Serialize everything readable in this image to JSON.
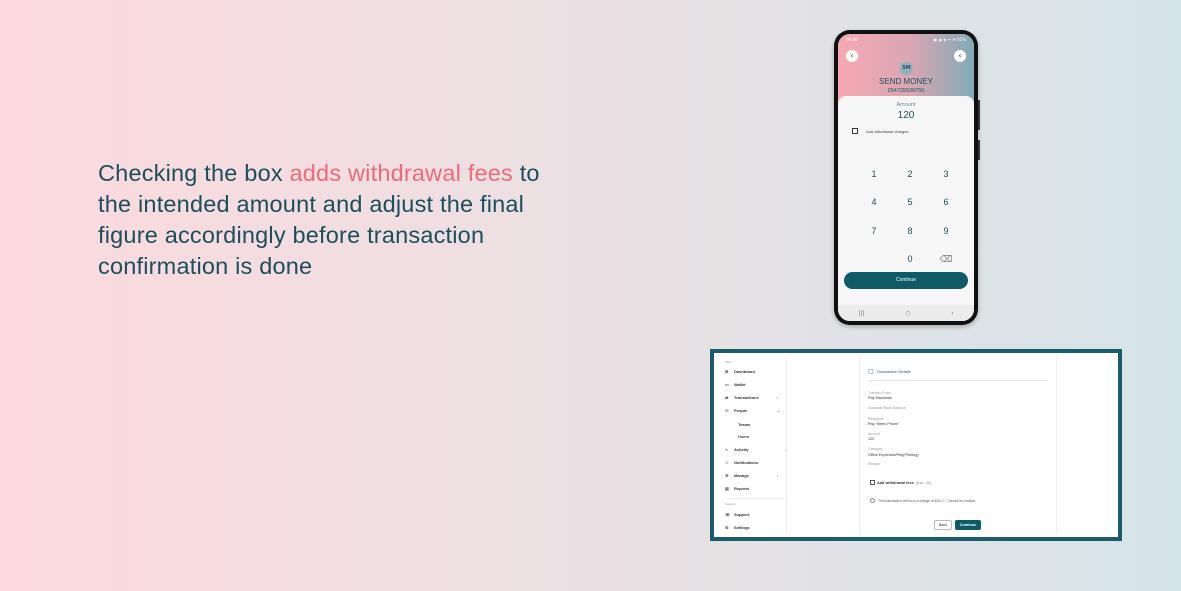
{
  "headline": {
    "part1": "Checking the box ",
    "highlight": "adds withdrawal fees",
    "part2": " to the intended amount and adjust the final figure accordingly  before transaction confirmation is done"
  },
  "colors": {
    "accent_pink": "#ec6b78",
    "text_teal": "#1b4f5c",
    "button_teal": "#0e5a65"
  },
  "phone": {
    "status_time": "09:36",
    "status_icons": "▣ ◉ ◈ ᯤ ✉ 61%",
    "avatar_initials": "SM",
    "title": "SEND MONEY",
    "phone_number": "254725538750",
    "amount_label": "Amount",
    "amount_value": "120",
    "withdrawal_label": "Add withdrawal charges",
    "withdrawal_checked": false,
    "keys": [
      "1",
      "2",
      "3",
      "4",
      "5",
      "6",
      "7",
      "8",
      "9",
      "",
      "0",
      "⌫"
    ],
    "continue_label": "Continue",
    "nav_icons": [
      "|||",
      "○",
      "‹"
    ]
  },
  "desktop": {
    "sidebar": {
      "heading_main": "Main",
      "items": [
        {
          "icon": "⊞",
          "label": "Dashboard",
          "chevron": ""
        },
        {
          "icon": "▭",
          "label": "Wallet",
          "chevron": ""
        },
        {
          "icon": "⇄",
          "label": "Transactions",
          "chevron": "›"
        },
        {
          "icon": "⚇",
          "label": "People",
          "chevron": "⌄"
        }
      ],
      "sub_items": [
        "Teams",
        "Users"
      ],
      "items2": [
        {
          "icon": "∿",
          "label": "Activity",
          "chevron": ""
        },
        {
          "icon": "♢",
          "label": "Notifications",
          "chevron": ""
        },
        {
          "icon": "⚙",
          "label": "Manage",
          "chevron": "›"
        },
        {
          "icon": "▤",
          "label": "Reports",
          "chevron": ""
        }
      ],
      "heading_support": "Support",
      "support_items": [
        {
          "icon": "☏",
          "label": "Support"
        },
        {
          "icon": "⚙",
          "label": "Settings"
        }
      ],
      "collapse_icon": "‹"
    },
    "panel": {
      "title": "Transaction Details",
      "fields": [
        {
          "label": "Transfer From",
          "value": "Pay Machines"
        },
        {
          "label": "Available Bank Balance",
          "value": ""
        },
        {
          "label": "Recipient",
          "value": "Pay: Metro Phone"
        },
        {
          "label": "Amount",
          "value": "120"
        },
        {
          "label": "Category",
          "value": "Office Expenses/Pay(Printing)"
        },
        {
          "label": "Reason",
          "value": ""
        }
      ],
      "fee_label": "Add withdrawal fees",
      "fee_note": "(Ksh. 33)",
      "notice": "This transaction will incur a charge of Ksh. 0 - Cannot be undone",
      "back_label": "Back",
      "continue_label": "Continue"
    }
  }
}
